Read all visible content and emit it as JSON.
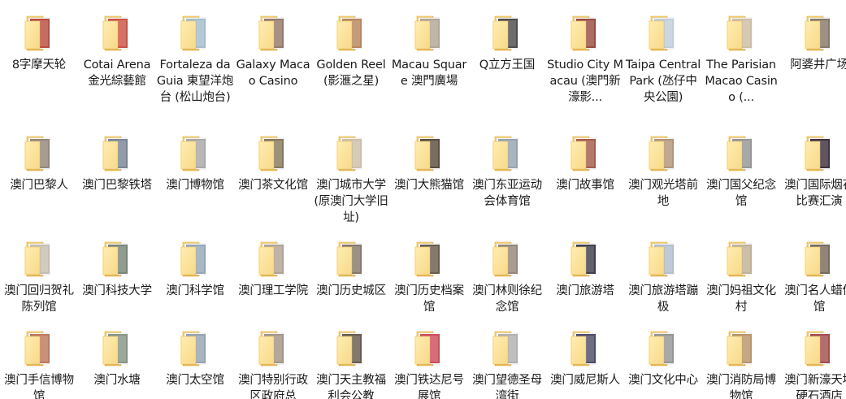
{
  "folders": [
    [
      {
        "label": "8字摩天轮",
        "thumb": "#b23a2a"
      },
      {
        "label": "Cotai Arena 金光綜藝館",
        "thumb": "#c8402e"
      },
      {
        "label": "Fortaleza da Guia 東望洋炮台 (松山炮台)",
        "thumb": "#9ab6c9"
      },
      {
        "label": "Galaxy Macao Casino",
        "thumb": "#8a6a5a"
      },
      {
        "label": "Golden Reel (影滙之星)",
        "thumb": "#b07a4a"
      },
      {
        "label": "Macau Square 澳門廣場",
        "thumb": "#a89c8c"
      },
      {
        "label": "Q立方王国",
        "thumb": "#3a3a3a"
      },
      {
        "label": "Studio City Macau (澳門新濠影...",
        "thumb": "#8e3a2e"
      },
      {
        "label": "Taipa Central Park (氹仔中央公園)",
        "thumb": "#b9c8d6"
      },
      {
        "label": "The Parisian Macao Casino (...",
        "thumb": "#c9b79a"
      },
      {
        "label": "阿婆井广场",
        "thumb": "#7a6a5a"
      }
    ],
    [
      {
        "label": "澳门巴黎人",
        "thumb": "#8a7a6a"
      },
      {
        "label": "澳门巴黎铁塔",
        "thumb": "#6a7a8a"
      },
      {
        "label": "澳门博物馆",
        "thumb": "#a0a0a0"
      },
      {
        "label": "澳门茶文化馆",
        "thumb": "#7a6a4a"
      },
      {
        "label": "澳门城市大学(原澳门大学旧址)",
        "thumb": "#c9b9a0"
      },
      {
        "label": "澳门大熊猫馆",
        "thumb": "#4a3a2a"
      },
      {
        "label": "澳门东亚运动会体育馆",
        "thumb": "#8a9aaa"
      },
      {
        "label": "澳门故事馆",
        "thumb": "#9a4a3a"
      },
      {
        "label": "澳门观光塔前地",
        "thumb": "#aa8a6a"
      },
      {
        "label": "澳门国父纪念馆",
        "thumb": "#8a8a8a"
      },
      {
        "label": "澳门国际烟花比赛汇演",
        "thumb": "#2a1a2a"
      }
    ],
    [
      {
        "label": "澳门回归贺礼陈列馆",
        "thumb": "#c0b8a8"
      },
      {
        "label": "澳门科技大学",
        "thumb": "#6a7a6a"
      },
      {
        "label": "澳门科学馆",
        "thumb": "#8aa0b0"
      },
      {
        "label": "澳门理工学院",
        "thumb": "#aa9a8a"
      },
      {
        "label": "澳门历史城区",
        "thumb": "#7a6a5a"
      },
      {
        "label": "澳门历史档案馆",
        "thumb": "#5a4a3a"
      },
      {
        "label": "澳门林则徐纪念馆",
        "thumb": "#8a7a6a"
      },
      {
        "label": "澳门旅游塔",
        "thumb": "#2a2a3a"
      },
      {
        "label": "澳门旅游塔蹦极",
        "thumb": "#a8b8c8"
      },
      {
        "label": "澳门妈祖文化村",
        "thumb": "#b9a98a"
      },
      {
        "label": "澳门名人蜡像馆",
        "thumb": "#6a5a4a"
      }
    ],
    [
      {
        "label": "澳门手信博物馆",
        "thumb": "#b86a4a"
      },
      {
        "label": "澳门水塘",
        "thumb": "#7a8a7a"
      },
      {
        "label": "澳门太空馆",
        "thumb": "#8a9aa8"
      },
      {
        "label": "澳门特别行政区政府总",
        "thumb": "#9a8a7a"
      },
      {
        "label": "澳门天主教福利会公教",
        "thumb": "#5a4a3a"
      },
      {
        "label": "澳门铁达尼号展馆",
        "thumb": "#c83a4a"
      },
      {
        "label": "澳门望德圣母湾街",
        "thumb": "#a8a8a8"
      },
      {
        "label": "澳门威尼斯人",
        "thumb": "#3a3a5a"
      },
      {
        "label": "澳门文化中心",
        "thumb": "#8a8a8a"
      },
      {
        "label": "澳门消防局博物馆",
        "thumb": "#b08a5a"
      },
      {
        "label": "澳门新濠天地硬石酒店",
        "thumb": "#9a3a3a"
      }
    ]
  ]
}
